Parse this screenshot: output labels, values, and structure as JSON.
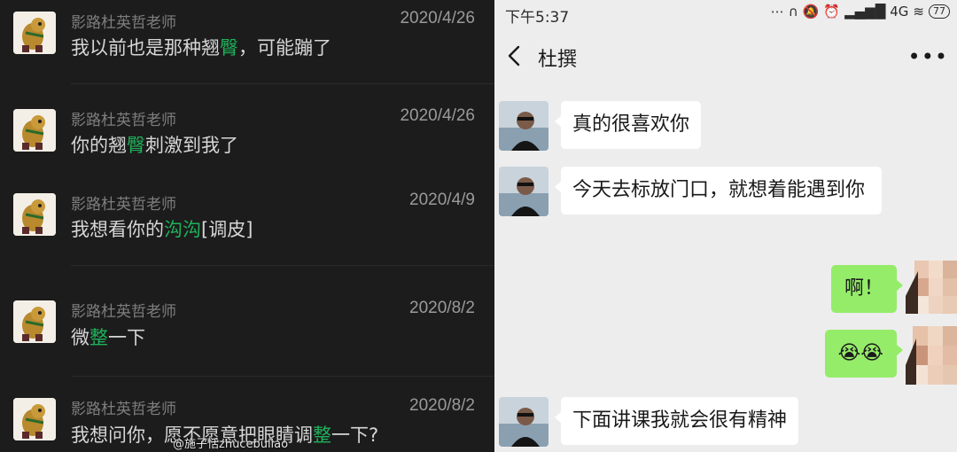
{
  "left": {
    "results": [
      {
        "name": "影路杜英哲老师",
        "date": "2020/4/26",
        "parts": [
          {
            "t": "我以前也是那种翘",
            "h": false
          },
          {
            "t": "臀",
            "h": true
          },
          {
            "t": "，可能蹦了",
            "h": false
          }
        ]
      },
      {
        "name": "影路杜英哲老师",
        "date": "2020/4/26",
        "parts": [
          {
            "t": "你的翘",
            "h": false
          },
          {
            "t": "臀",
            "h": true
          },
          {
            "t": "刺激到我了",
            "h": false
          }
        ]
      },
      {
        "name": "影路杜英哲老师",
        "date": "2020/4/9",
        "parts": [
          {
            "t": "我想看你的",
            "h": false
          },
          {
            "t": "沟沟",
            "h": true
          },
          {
            "t": "[调皮]",
            "h": false
          }
        ]
      },
      {
        "name": "影路杜英哲老师",
        "date": "2020/8/2",
        "parts": [
          {
            "t": "微",
            "h": false
          },
          {
            "t": "整",
            "h": true
          },
          {
            "t": "一下",
            "h": false
          }
        ]
      },
      {
        "name": "影路杜英哲老师",
        "date": "2020/8/2",
        "parts": [
          {
            "t": "我想问你，愿不愿意把眼睛调",
            "h": false
          },
          {
            "t": "整",
            "h": true
          },
          {
            "t": "一下?",
            "h": false
          }
        ]
      }
    ],
    "watermark": "@施子恬zhucebuliao",
    "highlight_color": "#1fb15a"
  },
  "right": {
    "status": {
      "time": "下午5:37",
      "network": "4G",
      "battery": "77"
    },
    "title": "杜撰",
    "messages": [
      {
        "dir": "in",
        "text": "真的很喜欢你"
      },
      {
        "dir": "in",
        "text": "今天去标放门口，就想着能遇到你"
      },
      {
        "dir": "out",
        "text": "啊！"
      },
      {
        "dir": "out",
        "text": "😭😭"
      },
      {
        "dir": "in",
        "text": "下面讲课我就会很有精神"
      }
    ],
    "colors": {
      "bubble_out": "#95ec69",
      "bubble_in": "#ffffff",
      "background": "#ededed"
    }
  }
}
